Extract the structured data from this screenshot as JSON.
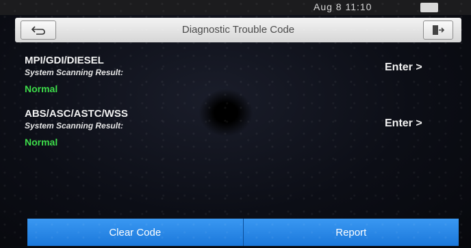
{
  "status_bar": {
    "text": "Aug 8   11:10"
  },
  "header": {
    "title": "Diagnostic Trouble Code",
    "back_icon": "back-arrow-icon",
    "exit_icon": "exit-icon"
  },
  "modules": [
    {
      "name": "MPI/GDI/DIESEL",
      "scan_label": "System Scanning Result:",
      "result": "Normal",
      "action": "Enter >"
    },
    {
      "name": "ABS/ASC/ASTC/WSS",
      "scan_label": "System Scanning Result:",
      "result": "Normal",
      "action": "Enter >"
    }
  ],
  "footer": {
    "clear_label": "Clear Code",
    "report_label": "Report"
  },
  "colors": {
    "accent": "#2a8ae8",
    "result_ok": "#3ddc4a",
    "header_bg": "#e6e6e6"
  }
}
